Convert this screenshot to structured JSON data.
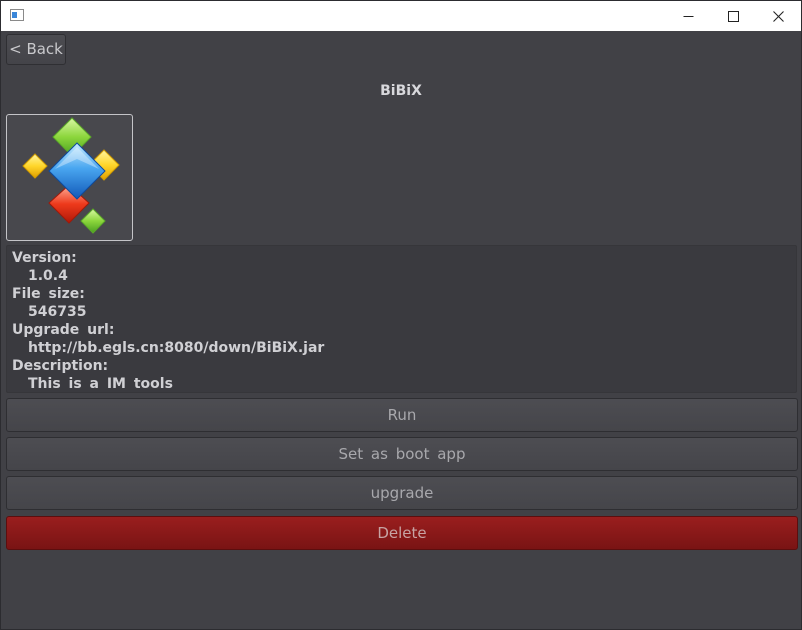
{
  "window": {
    "controls": {
      "minimize_icon": "minimize-icon",
      "maximize_icon": "maximize-icon",
      "close_icon": "close-icon"
    }
  },
  "nav": {
    "back_label": "< Back"
  },
  "app": {
    "name": "BiBiX",
    "icon": "app-logo-gems",
    "info": {
      "version_label": "Version:",
      "version": "1.0.4",
      "file_size_label": "File size:",
      "file_size": "546735",
      "upgrade_url_label": "Upgrade url:",
      "upgrade_url": "http://bb.egls.cn:8080/down/BiBiX.jar",
      "description_label": "Description:",
      "description": "This is a IM tools"
    }
  },
  "actions": {
    "run": "Run",
    "set_boot": "Set as boot app",
    "upgrade": "upgrade",
    "delete": "Delete"
  },
  "colors": {
    "background": "#414146",
    "panel": "#3a3a3f",
    "delete_button": "#8b1a1a",
    "text": "#d0d0d4"
  }
}
